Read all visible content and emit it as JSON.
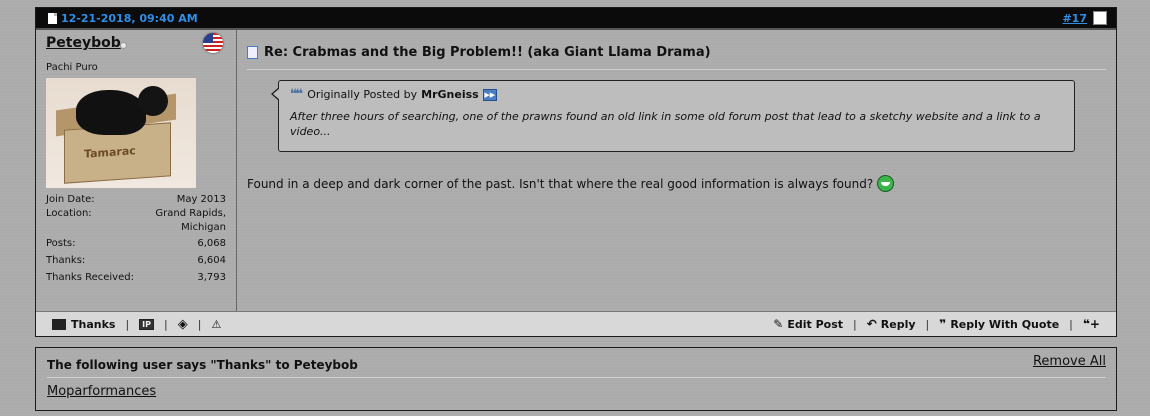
{
  "post": {
    "date": "12-21-2018, 09:40 AM",
    "number": "#17",
    "user": {
      "name": "Peteybob",
      "title": "Pachi Puro",
      "avatar_text": "Tamarac",
      "stats": [
        {
          "label": "Join Date:",
          "value": "May 2013"
        },
        {
          "label": "Location:",
          "value": "Grand Rapids, Michigan"
        },
        {
          "label": "Posts:",
          "value": "6,068"
        },
        {
          "label": "Thanks:",
          "value": "6,604"
        },
        {
          "label": "Thanks Received:",
          "value": "3,793"
        }
      ]
    },
    "title": "Re: Crabmas and the Big Problem!! (aka Giant Llama Drama)",
    "quote": {
      "prefix": "Originally Posted by",
      "author": "MrGneiss",
      "text": "After three hours of searching, one of the prawns found an old link in some old forum post that lead to a sketchy website and a link to a video..."
    },
    "message": "Found in a deep and dark corner of the past. Isn't that where the real good information is always found?"
  },
  "actions": {
    "thanks": "Thanks",
    "ip_label": "IP",
    "edit": "Edit Post",
    "reply": "Reply",
    "reply_quote": "Reply With Quote"
  },
  "thanks_box": {
    "header": "The following user says \"Thanks\" to Peteybob",
    "remove_all": "Remove All",
    "users": [
      "Moparformances"
    ]
  },
  "icons": {
    "flag": "us-flag-icon",
    "smile": "big-grin-icon",
    "colors": {
      "link": "#2f8fe8",
      "header_bg": "#0b0b0b"
    }
  }
}
